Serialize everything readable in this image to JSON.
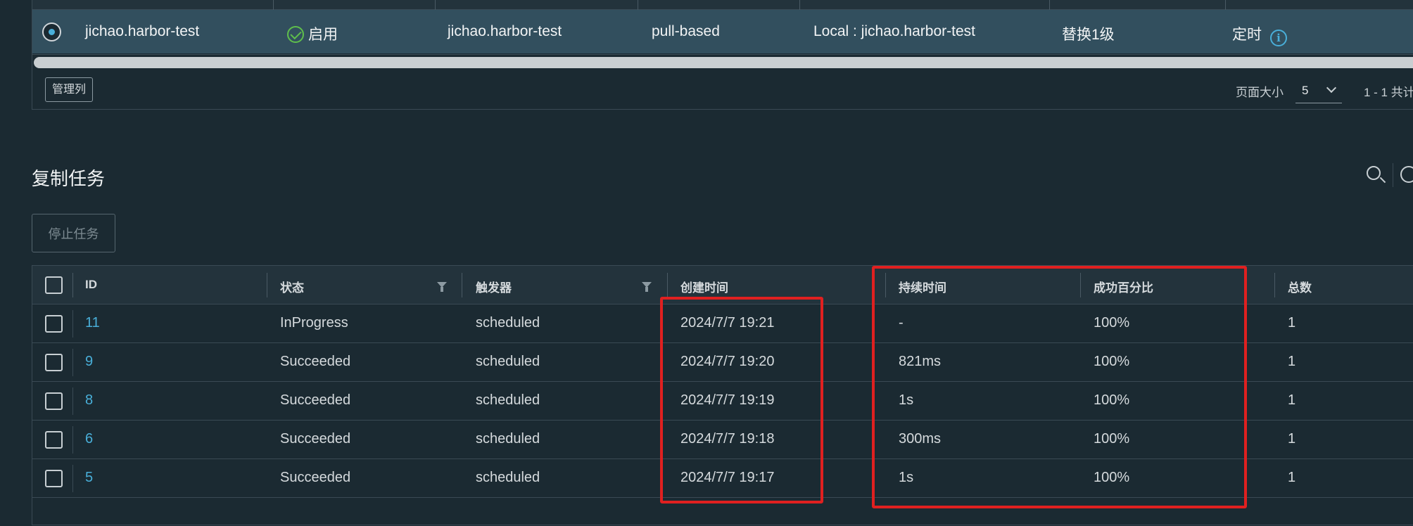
{
  "rules_table": {
    "row": {
      "name": "jichao.harbor-test",
      "status_label": "启用",
      "source": "jichao.harbor-test",
      "mode": "pull-based",
      "destination": "Local : jichao.harbor-test",
      "flattening": "替换1级",
      "trigger": "定时"
    },
    "manage_columns_label": "管理列",
    "page_size_label": "页面大小",
    "page_size_value": "5",
    "count_text": "1 - 1 共计"
  },
  "executions": {
    "title": "复制任务",
    "stop_button_label": "停止任务",
    "columns": [
      "ID",
      "状态",
      "触发器",
      "创建时间",
      "持续时间",
      "成功百分比",
      "总数"
    ],
    "rows": [
      {
        "id": "11",
        "status": "InProgress",
        "trigger": "scheduled",
        "created": "2024/7/7 19:21",
        "duration": "-",
        "success": "100%",
        "total": "1"
      },
      {
        "id": "9",
        "status": "Succeeded",
        "trigger": "scheduled",
        "created": "2024/7/7 19:20",
        "duration": "821ms",
        "success": "100%",
        "total": "1"
      },
      {
        "id": "8",
        "status": "Succeeded",
        "trigger": "scheduled",
        "created": "2024/7/7 19:19",
        "duration": "1s",
        "success": "100%",
        "total": "1"
      },
      {
        "id": "6",
        "status": "Succeeded",
        "trigger": "scheduled",
        "created": "2024/7/7 19:18",
        "duration": "300ms",
        "success": "100%",
        "total": "1"
      },
      {
        "id": "5",
        "status": "Succeeded",
        "trigger": "scheduled",
        "created": "2024/7/7 19:17",
        "duration": "1s",
        "success": "100%",
        "total": "1"
      }
    ]
  },
  "colors": {
    "background": "#1b2a32",
    "selected_row": "#324f5e",
    "link": "#49afd9",
    "annotation": "#e02020"
  }
}
